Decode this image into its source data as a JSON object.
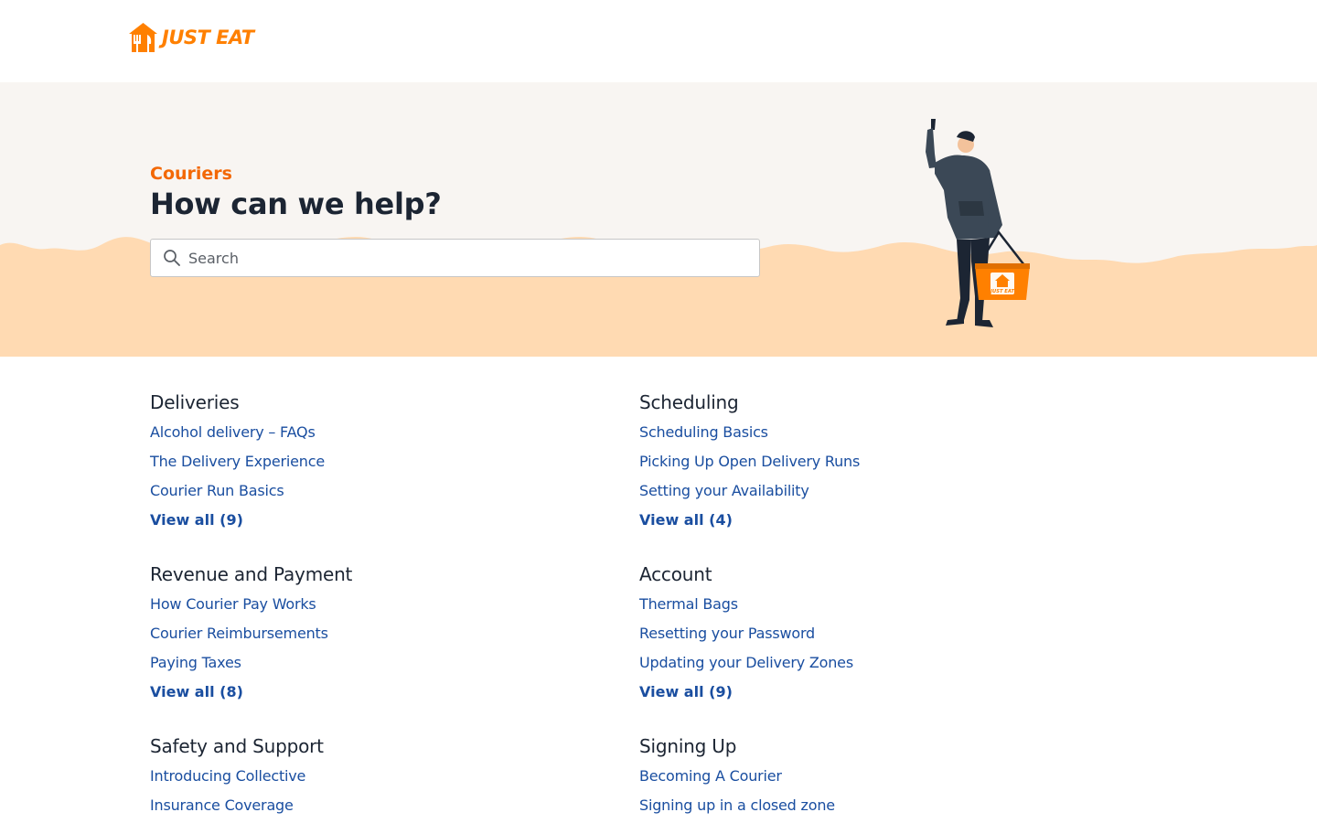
{
  "header": {
    "logo_text": "JUST EAT",
    "logo_icon": "house-with-cutlery-icon"
  },
  "hero": {
    "kicker": "Couriers",
    "title": "How can we help?",
    "search": {
      "placeholder": "Search",
      "value": ""
    },
    "illustration": "courier-with-basket-illustration",
    "basket_label": "JUST EAT"
  },
  "colors": {
    "brand_orange": "#ff8000",
    "kicker_orange": "#f36805",
    "link_blue": "#1a4ea0",
    "hero_bg": "#f8f5f2",
    "hero_wave": "#ffdab2",
    "heading_text": "#1c2533"
  },
  "sections": [
    {
      "title": "Deliveries",
      "articles": [
        "Alcohol delivery – FAQs",
        "The Delivery Experience",
        "Courier Run Basics"
      ],
      "view_all": "View all (9)"
    },
    {
      "title": "Scheduling",
      "articles": [
        "Scheduling Basics",
        "Picking Up Open Delivery Runs",
        "Setting your Availability"
      ],
      "view_all": "View all (4)"
    },
    {
      "title": "Revenue and Payment",
      "articles": [
        "How Courier Pay Works",
        "Courier Reimbursements",
        "Paying Taxes"
      ],
      "view_all": "View all (8)"
    },
    {
      "title": "Account",
      "articles": [
        "Thermal Bags",
        "Resetting your Password",
        "Updating your Delivery Zones"
      ],
      "view_all": "View all (9)"
    },
    {
      "title": "Safety and Support",
      "articles": [
        "Introducing Collective",
        "Insurance Coverage"
      ],
      "view_all": ""
    },
    {
      "title": "Signing Up",
      "articles": [
        "Becoming A Courier",
        "Signing up in a closed zone"
      ],
      "view_all": ""
    }
  ]
}
